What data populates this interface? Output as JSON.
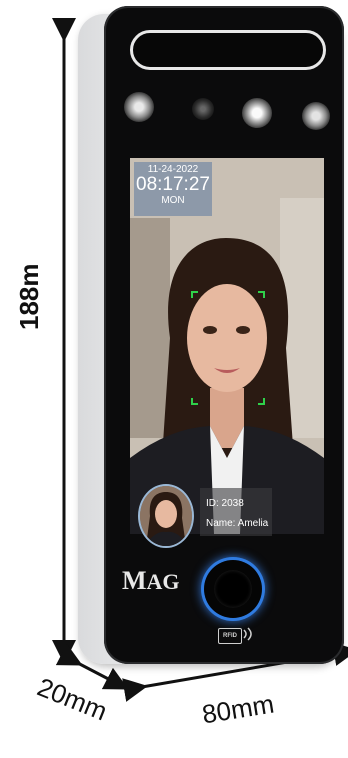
{
  "dimensions": {
    "height_label": "188m",
    "depth_label": "20mm",
    "width_label": "80mm"
  },
  "screen": {
    "date": "11-24-2022",
    "time": "08:17:27",
    "day": "MON",
    "person_id": "ID: 2038",
    "person_name": "Name: Amelia"
  },
  "device": {
    "logo_first": "M",
    "logo_rest": "AG",
    "rfid_label": "RFID"
  },
  "colors": {
    "ring_glow": "#2f7be0",
    "face_frame": "#2fd14a",
    "device_front": "#0b0b0c"
  }
}
